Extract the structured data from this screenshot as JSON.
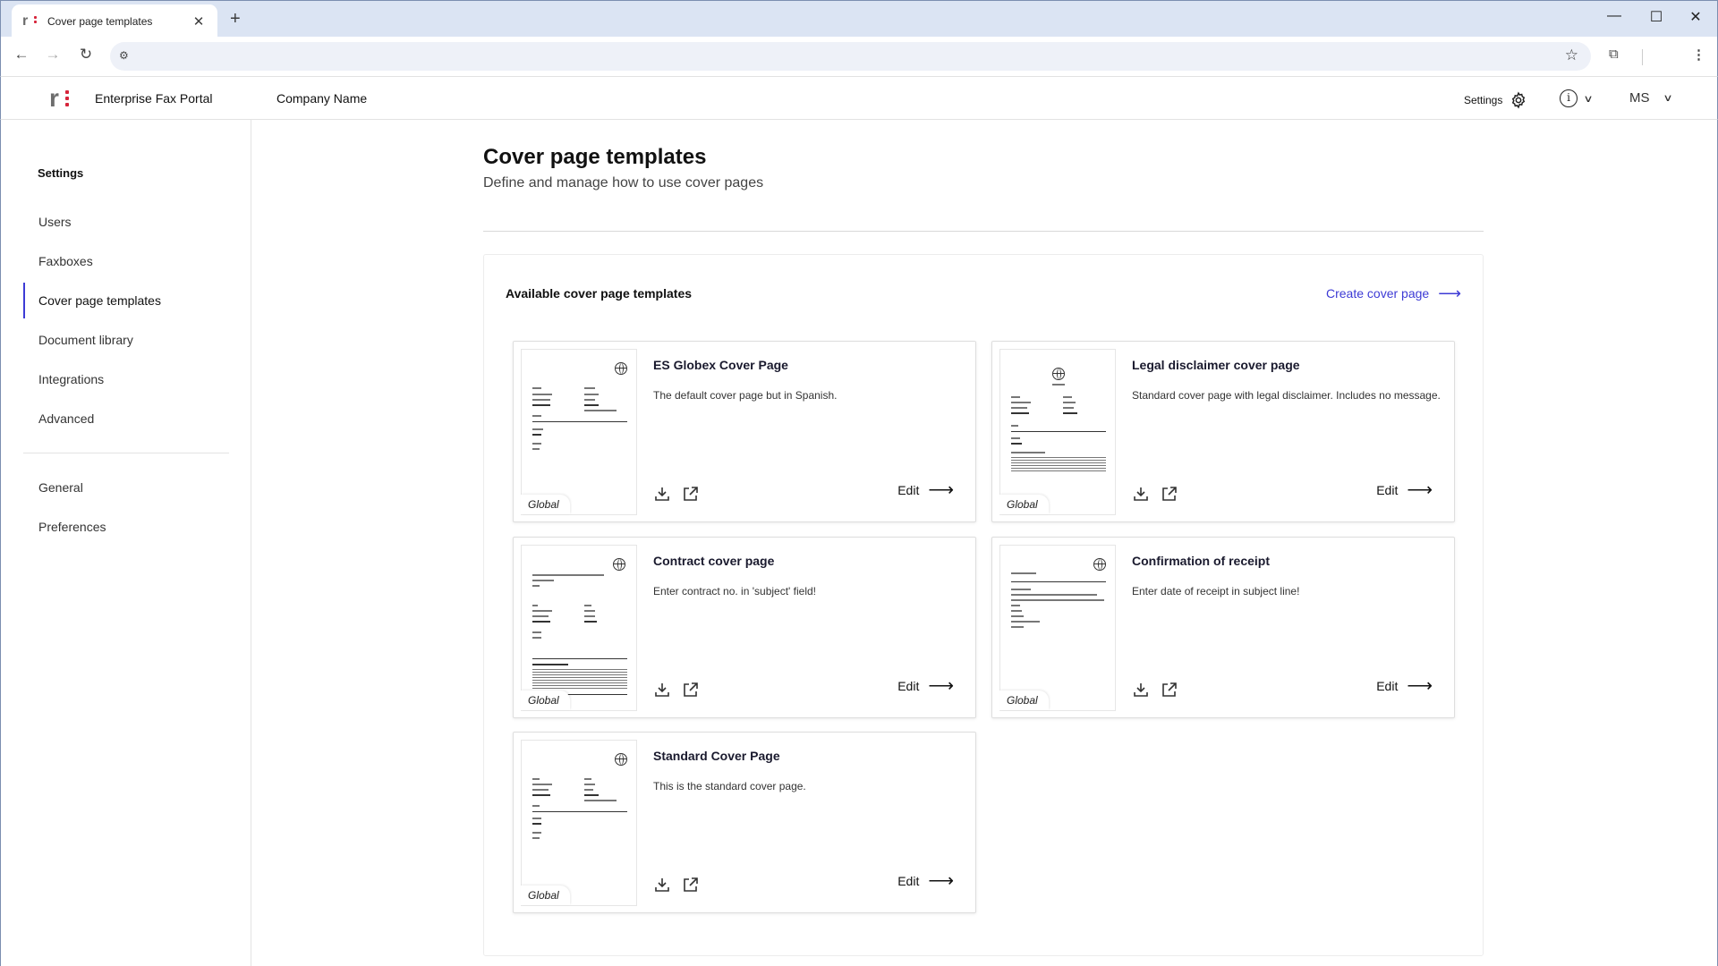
{
  "browser": {
    "tab_title": "Cover page templates",
    "tab_close": "✕",
    "new_tab": "+"
  },
  "header": {
    "portal_title": "Enterprise Fax Portal",
    "company": "Company Name",
    "settings_label": "Settings",
    "user_initials": "MS"
  },
  "sidebar": {
    "heading": "Settings",
    "items": [
      {
        "label": "Users"
      },
      {
        "label": "Faxboxes"
      },
      {
        "label": "Cover page templates"
      },
      {
        "label": "Document library"
      },
      {
        "label": "Integrations"
      },
      {
        "label": "Advanced"
      },
      {
        "label": "General"
      },
      {
        "label": "Preferences"
      }
    ],
    "active_item": "Cover page templates"
  },
  "main": {
    "title": "Cover page templates",
    "subtitle": "Define and manage how to use cover pages",
    "panel_title": "Available cover page templates",
    "create_label": "Create cover page",
    "cards": [
      {
        "title": "ES Globex Cover Page",
        "description": "The default cover page but in Spanish.",
        "scope": "Global",
        "edit_label": "Edit"
      },
      {
        "title": "Legal disclaimer cover page",
        "description": "Standard cover page with legal disclaimer. Includes no message.",
        "scope": "Global",
        "edit_label": "Edit"
      },
      {
        "title": "Contract cover page",
        "description": "Enter contract no. in 'subject' field!",
        "scope": "Global",
        "edit_label": "Edit"
      },
      {
        "title": "Confirmation of receipt",
        "description": "Enter date of receipt in subject line!",
        "scope": "Global",
        "edit_label": "Edit"
      },
      {
        "title": "Standard Cover Page",
        "description": "This is the standard cover page.",
        "scope": "Global",
        "edit_label": "Edit"
      }
    ]
  },
  "colors": {
    "accent": "#3d3bd5",
    "brand_red": "#d6243a"
  }
}
